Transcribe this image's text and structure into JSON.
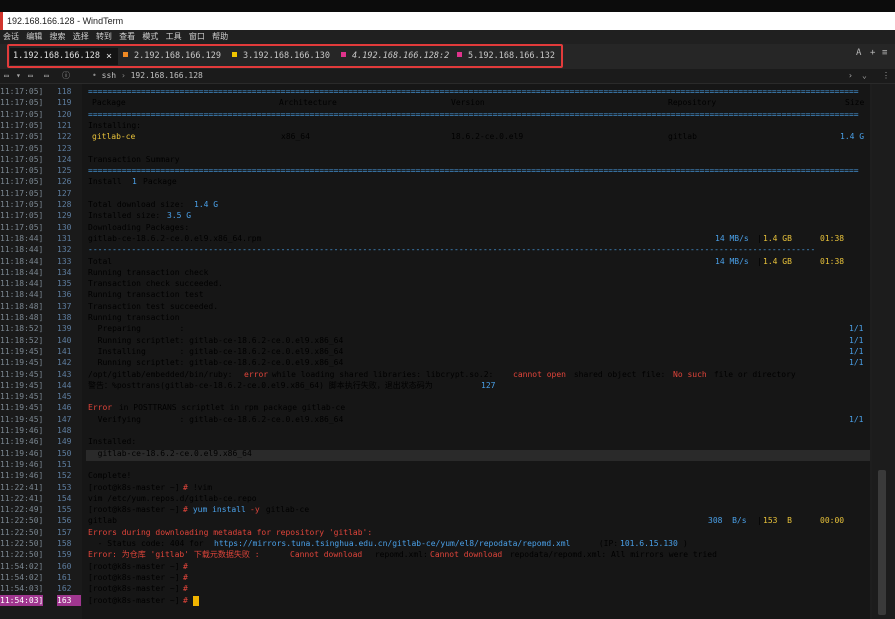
{
  "window": {
    "title": "192.168.166.128 - WindTerm"
  },
  "menu": [
    "会话",
    "编辑",
    "搜索",
    "选择",
    "转到",
    "查看",
    "模式",
    "工具",
    "窗口",
    "帮助"
  ],
  "tabs": [
    {
      "label": "1.192.168.166.128",
      "color": "#d0d0d0",
      "active": true
    },
    {
      "label": "2.192.168.166.129",
      "color": "#f08a24",
      "active": false
    },
    {
      "label": "3.192.168.166.130",
      "color": "#f0c400",
      "active": false
    },
    {
      "label": "4.192.168.166.128:2",
      "color": "#e0338c",
      "active": false
    },
    {
      "label": "5.192.168.166.132",
      "color": "#e0338c",
      "active": false
    }
  ],
  "tab_close": "×",
  "tab_right": {
    "a": "A",
    "plus": "+",
    "menu": "≡"
  },
  "toolbar": {
    "path_ssh": "ssh",
    "sep": "›",
    "path_host": "192.168.166.128",
    "chevron": "›",
    "dropdown": "⌄",
    "more": "⋮"
  },
  "gutter": [
    {
      "ts": "11:17:05]",
      "ln": "118"
    },
    {
      "ts": "11:17:05]",
      "ln": "119"
    },
    {
      "ts": "11:17:05]",
      "ln": "120"
    },
    {
      "ts": "11:17:05]",
      "ln": "121"
    },
    {
      "ts": "11:17:05]",
      "ln": "122"
    },
    {
      "ts": "11:17:05]",
      "ln": "123"
    },
    {
      "ts": "11:17:05]",
      "ln": "124"
    },
    {
      "ts": "11:17:05]",
      "ln": "125"
    },
    {
      "ts": "11:17:05]",
      "ln": "126"
    },
    {
      "ts": "11:17:05]",
      "ln": "127"
    },
    {
      "ts": "11:17:05]",
      "ln": "128"
    },
    {
      "ts": "11:17:05]",
      "ln": "129"
    },
    {
      "ts": "11:17:05]",
      "ln": "130"
    },
    {
      "ts": "11:18:44]",
      "ln": "131"
    },
    {
      "ts": "11:18:44]",
      "ln": "132"
    },
    {
      "ts": "11:18:44]",
      "ln": "133"
    },
    {
      "ts": "11:18:44]",
      "ln": "134"
    },
    {
      "ts": "11:18:44]",
      "ln": "135"
    },
    {
      "ts": "11:18:44]",
      "ln": "136"
    },
    {
      "ts": "11:18:48]",
      "ln": "137"
    },
    {
      "ts": "11:18:48]",
      "ln": "138"
    },
    {
      "ts": "11:18:52]",
      "ln": "139"
    },
    {
      "ts": "11:18:52]",
      "ln": "140"
    },
    {
      "ts": "11:19:45]",
      "ln": "141"
    },
    {
      "ts": "11:19:45]",
      "ln": "142"
    },
    {
      "ts": "11:19:45]",
      "ln": "143"
    },
    {
      "ts": "11:19:45]",
      "ln": "144"
    },
    {
      "ts": "11:19:45]",
      "ln": "145"
    },
    {
      "ts": "11:19:45]",
      "ln": "146"
    },
    {
      "ts": "11:19:45]",
      "ln": "147"
    },
    {
      "ts": "11:19:46]",
      "ln": "148"
    },
    {
      "ts": "11:19:46]",
      "ln": "149"
    },
    {
      "ts": "11:19:46]",
      "ln": "150"
    },
    {
      "ts": "11:19:46]",
      "ln": "151"
    },
    {
      "ts": "11:19:46]",
      "ln": "152"
    },
    {
      "ts": "11:22:41]",
      "ln": "153"
    },
    {
      "ts": "11:22:41]",
      "ln": "154"
    },
    {
      "ts": "11:22:49]",
      "ln": "155"
    },
    {
      "ts": "11:22:50]",
      "ln": "156"
    },
    {
      "ts": "11:22:50]",
      "ln": "157"
    },
    {
      "ts": "11:22:50]",
      "ln": "158"
    },
    {
      "ts": "11:22:50]",
      "ln": "159"
    },
    {
      "ts": "11:54:02]",
      "ln": "160"
    },
    {
      "ts": "11:54:02]",
      "ln": "161"
    },
    {
      "ts": "11:54:03]",
      "ln": "162"
    },
    {
      "ts": "11:54:03]",
      "ln": "163"
    }
  ],
  "out": {
    "sep_eq": "================================================================================================================================================================",
    "sep_dash": "-------------------------------------------------------------------------------------------------------------------------------------------------------",
    "h_package": "Package",
    "h_arch": "Architecture",
    "h_version": "Version",
    "h_repo": "Repository",
    "h_size": "Size",
    "installing": "Installing:",
    "pkg_name": "gitlab-ce",
    "pkg_arch": "x86_64",
    "pkg_version": "18.6.2-ce.0.el9",
    "pkg_repo": "gitlab",
    "pkg_size": "1.4 G",
    "txn_summary": "Transaction Summary",
    "install_a": "Install",
    "install_n": "1",
    "install_b": "Package",
    "dl_size_a": "Total download size: ",
    "dl_size_b": "1.4 G",
    "inst_size_a": "Installed size: ",
    "inst_size_b": "3.5 G",
    "downloading": "Downloading Packages:",
    "rpm_file": "gitlab-ce-18.6.2-ce.0.el9.x86_64.rpm",
    "rate": "14 MB/s",
    "bar": "|",
    "size_gb": "1.4 GB",
    "eta": "01:38",
    "total": "Total",
    "run_check": "Running transaction check",
    "check_ok": "Transaction check succeeded.",
    "run_test": "Running transaction test",
    "test_ok": "Transaction test succeeded.",
    "run_txn": "Running transaction",
    "preparing": "  Preparing        :",
    "scriptlet": "  Running scriptlet: gitlab-ce-18.6.2-ce.0.el9.x86_64",
    "installing2": "  Installing       : gitlab-ce-18.6.2-ce.0.el9.x86_64",
    "prog": "1/1",
    "ruby_a": "/opt/gitlab/embedded/bin/ruby: ",
    "ruby_err": "error",
    "ruby_b": " while loading shared libraries: libcrypt.so.2: ",
    "ruby_cannot": "cannot open",
    "ruby_c": " shared object file: ",
    "ruby_no": "No such",
    "ruby_d": " file or directory",
    "warn_a": "警告：%posttrans(gitlab-ce-18.6.2-ce.0.el9.x86_64) 脚本执行失败，退出状态码为 ",
    "warn_code": "127",
    "err_word": "Error",
    "err_rest": " in POSTTRANS scriptlet in rpm package gitlab-ce",
    "verifying": "  Verifying        : gitlab-ce-18.6.2-ce.0.el9.x86_64",
    "installed": "Installed:",
    "installed_pkg": "  gitlab-ce-18.6.2-ce.0.el9.x86_64",
    "complete": "Complete!",
    "prompt": "[root@k8s-master ~]",
    "hash": "#",
    "cmd_vim": " !vim",
    "vim_line": "vim /etc/yum.repos.d/gitlab-ce.repo",
    "cmd_yum_a": " yum install ",
    "cmd_yum_flag": "-y",
    "cmd_yum_b": " gitlab-ce",
    "gitlab": "gitlab",
    "rate2": "308  B/s",
    "size2": "153  B",
    "eta2": "00:00",
    "errors_dl": "Errors during downloading metadata for repository 'gitlab':",
    "status_a": "  - Status code: 404 for ",
    "status_url": "https://mirrors.tuna.tsinghua.edu.cn/gitlab-ce/yum/el8/repodata/repomd.xml",
    "status_b": " (IP: ",
    "status_ip": "101.6.15.130",
    "status_c": ")",
    "err2_a": "Error: 为仓库 'gitlab' 下载元数据失败 : ",
    "err2_cannot": "Cannot download",
    "err2_b": " repomd.xml: ",
    "err2_c": " repodata/repomd.xml: All mirrors were tried"
  }
}
